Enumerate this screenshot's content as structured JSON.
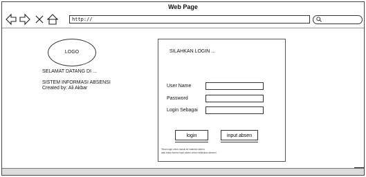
{
  "window": {
    "title": "Web Page"
  },
  "toolbar": {
    "url": "http://"
  },
  "brand": {
    "logo_label": "LOGO",
    "welcome": "SELAMAT DATANG DI ...",
    "system_name": "SISTEM INFORMASI ABSENSI",
    "credit": "Created by: Ali Akbar"
  },
  "login": {
    "title": "SILAHKAN LOGIN ...",
    "fields": [
      {
        "label": "User Name",
        "value": ""
      },
      {
        "label": "Password",
        "value": ""
      },
      {
        "label": "Login Sebagai",
        "value": ""
      }
    ],
    "login_button": "login",
    "absen_button": "input absen",
    "note_line1": "Tekan login untuk masuk ke halaman sistem,",
    "note_line2": "atau tekan tombol input absen untuk melakukan absensi"
  }
}
